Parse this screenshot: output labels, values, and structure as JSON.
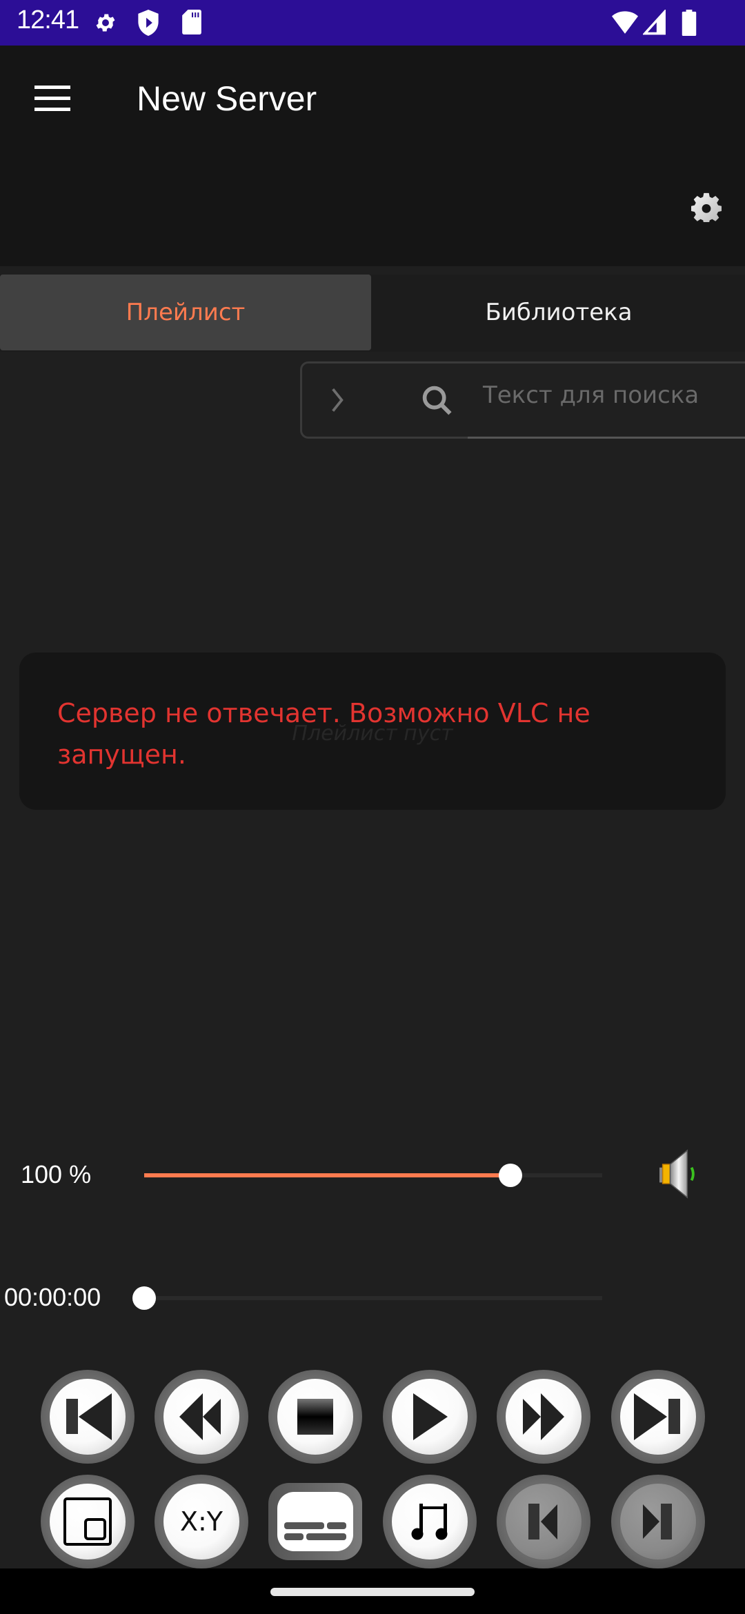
{
  "status_bar": {
    "time": "12:41",
    "left_icons": [
      "settings-icon",
      "shield-play-icon",
      "sd-card-icon"
    ],
    "right_icons": [
      "wifi-icon",
      "cell-signal-icon",
      "battery-icon"
    ],
    "background": "#2c0e96"
  },
  "app_bar": {
    "menu_icon": "hamburger-menu-icon",
    "title": "New Server",
    "settings_icon": "gear-icon"
  },
  "tabs": [
    {
      "label": "Плейлист",
      "active": true
    },
    {
      "label": "Библиотека",
      "active": false
    }
  ],
  "search": {
    "expand_icon": "chevron-right-icon",
    "search_icon": "search-icon",
    "value": "",
    "placeholder": "Текст для поиска"
  },
  "playlist": {
    "empty_text": "Плейлист пуст"
  },
  "error": {
    "message": "Сервер не отвечает. Возможно VLC не запущен."
  },
  "volume": {
    "label": "100 %",
    "value_percent": 100,
    "max_percent": 125,
    "icon": "speaker-icon"
  },
  "position": {
    "time": "00:00:00",
    "progress": 0
  },
  "controls_row1": [
    {
      "name": "skip-previous",
      "icon": "skip-previous-icon"
    },
    {
      "name": "rewind",
      "icon": "rewind-icon"
    },
    {
      "name": "stop",
      "icon": "stop-icon"
    },
    {
      "name": "play",
      "icon": "play-icon"
    },
    {
      "name": "fast-forward",
      "icon": "fast-forward-icon"
    },
    {
      "name": "skip-next",
      "icon": "skip-next-icon"
    }
  ],
  "controls_row2": [
    {
      "name": "fullscreen",
      "icon": "fullscreen-window-icon"
    },
    {
      "name": "aspect-ratio",
      "icon": "aspect-ratio-icon",
      "label": "X:Y"
    },
    {
      "name": "subtitles",
      "icon": "subtitles-icon"
    },
    {
      "name": "audio-track",
      "icon": "music-note-icon"
    },
    {
      "name": "frame-back",
      "icon": "frame-back-icon",
      "disabled": true
    },
    {
      "name": "frame-forward",
      "icon": "frame-forward-icon",
      "disabled": true
    }
  ],
  "colors": {
    "accent": "#ff7b4f",
    "error": "#e23430",
    "background": "#1f1f1f",
    "app_bar": "#151515"
  }
}
